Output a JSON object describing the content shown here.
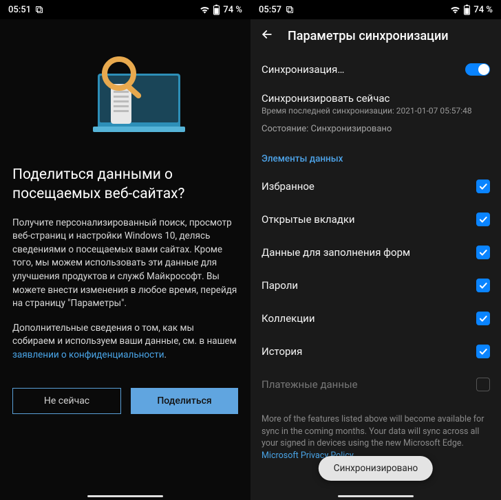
{
  "left": {
    "status": {
      "time": "05:51",
      "battery": "74 %"
    },
    "title": "Поделиться данными о посещаемых веб-сайтах?",
    "body1": "Получите персонализированный поиск, просмотр веб-страниц и настройки Windows 10, делясь сведениями о посещаемых вами сайтах. Кроме того, мы можем использовать эти данные для улучшения продуктов и служб Майкрософт. Вы можете внести изменения в любое время, перейдя на страницу \"Параметры\".",
    "body2_prefix": "Дополнительные сведения о том, как мы собираем и используем ваши данные, см. в нашем ",
    "body2_link": "заявлении о конфиденциальности",
    "body2_suffix": ".",
    "btn_secondary": "Не сейчас",
    "btn_primary": "Поделиться"
  },
  "right": {
    "status": {
      "time": "05:57",
      "battery": "74 %"
    },
    "header": "Параметры синхронизации",
    "sync_toggle_label": "Синхронизация…",
    "sync_now_label": "Синхронизировать сейчас",
    "sync_last": "Время последней синхронизации: 2021-01-07 05:57:48",
    "status_line": "Состояние: Синхронизировано",
    "section": "Элементы данных",
    "items": [
      {
        "label": "Избранное",
        "checked": true
      },
      {
        "label": "Открытые вкладки",
        "checked": true
      },
      {
        "label": "Данные для заполнения форм",
        "checked": true
      },
      {
        "label": "Пароли",
        "checked": true
      },
      {
        "label": "Коллекции",
        "checked": true
      },
      {
        "label": "История",
        "checked": true
      },
      {
        "label": "Платежные данные",
        "checked": false,
        "disabled": true
      }
    ],
    "footer_prefix": "More of the features listed above will become available for sync in the coming months. Your data will sync across all your signed in devices using the new Microsoft Edge. ",
    "footer_link": "Microsoft Privacy Policy",
    "footer_suffix": ".",
    "toast": "Синхронизировано"
  }
}
